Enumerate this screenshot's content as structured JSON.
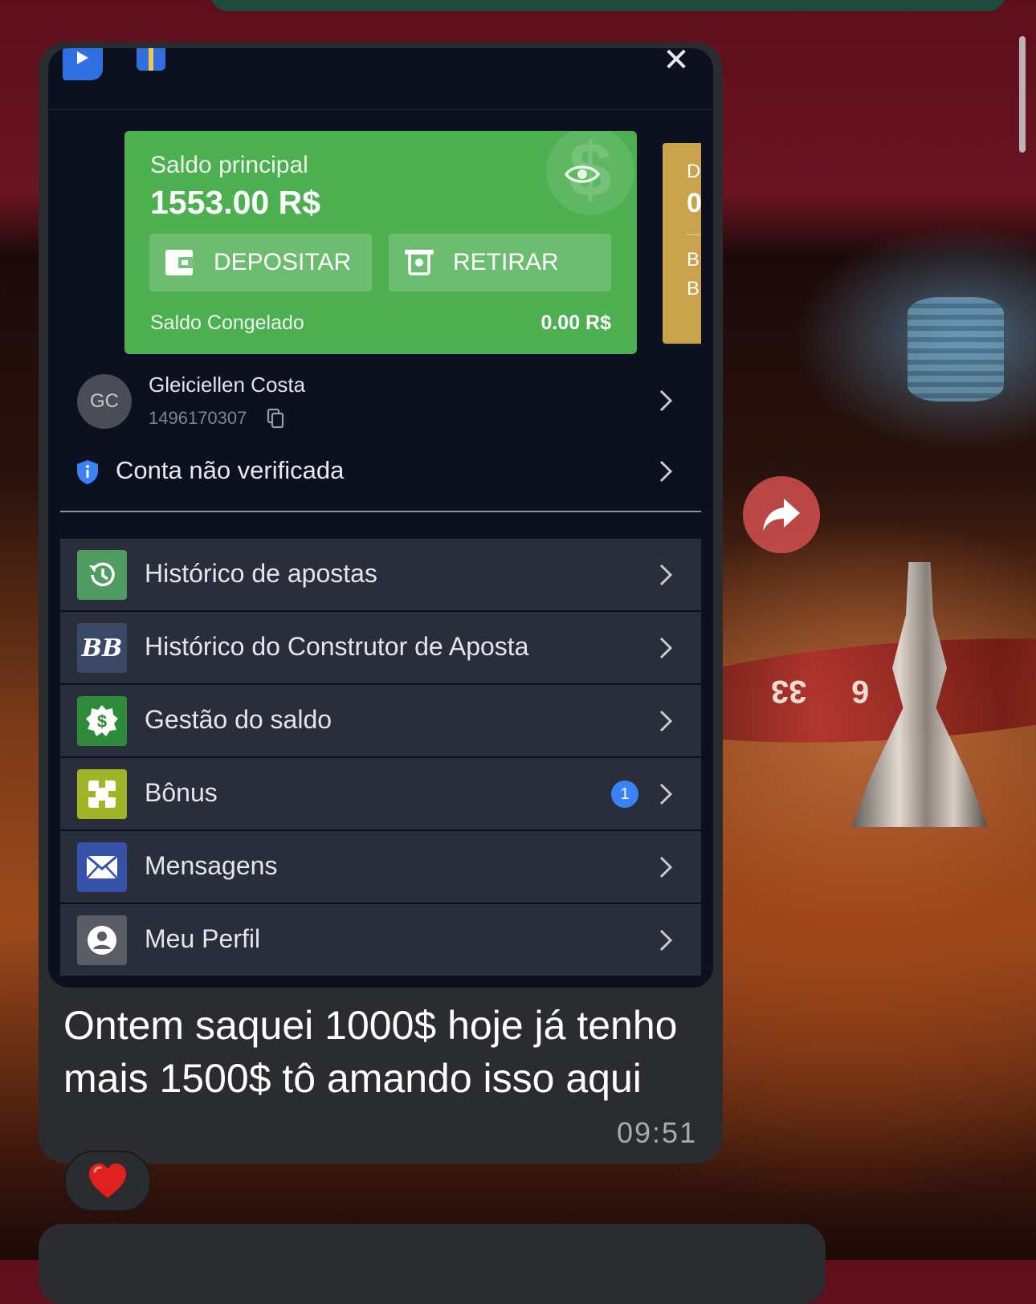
{
  "app": {
    "close_glyph": "✕"
  },
  "balance": {
    "main_label": "Saldo principal",
    "main_value": "1553.00 R$",
    "deposit_label": "DEPOSITAR",
    "withdraw_label": "RETIRAR",
    "frozen_label": "Saldo Congelado",
    "frozen_value": "0.00 R$",
    "card_color": "#4caf50"
  },
  "peek_card": {
    "line1": "D",
    "line2": "0",
    "line3": "B",
    "line4": "B"
  },
  "user": {
    "initials": "GC",
    "name": "Gleiciellen Costa",
    "id": "1496170307"
  },
  "verification": {
    "label": "Conta não verificada"
  },
  "menu": {
    "items": [
      {
        "label": "Histórico de apostas",
        "icon": "history-icon",
        "color": "#4f9b62"
      },
      {
        "label": "Histórico do Construtor de Aposta",
        "icon": "bet-builder-icon",
        "color": "#3a4a66"
      },
      {
        "label": "Gestão do saldo",
        "icon": "money-gear-icon",
        "color": "#2e8b3a"
      },
      {
        "label": "Bônus",
        "icon": "bonus-icon",
        "color": "#9fb526",
        "badge": "1"
      },
      {
        "label": "Mensagens",
        "icon": "envelope-icon",
        "color": "#3552a8"
      },
      {
        "label": "Meu Perfil",
        "icon": "profile-icon",
        "color": "#5a5d63"
      }
    ]
  },
  "message": {
    "caption": "Ontem saquei 1000$ hoje já tenho mais 1500$ tô amando isso aqui",
    "time": "09:51",
    "reaction": "❤️"
  },
  "colors": {
    "accent_blue": "#3b82f6",
    "bubble": "#2b2c2f",
    "app_bg": "#0d111f"
  }
}
